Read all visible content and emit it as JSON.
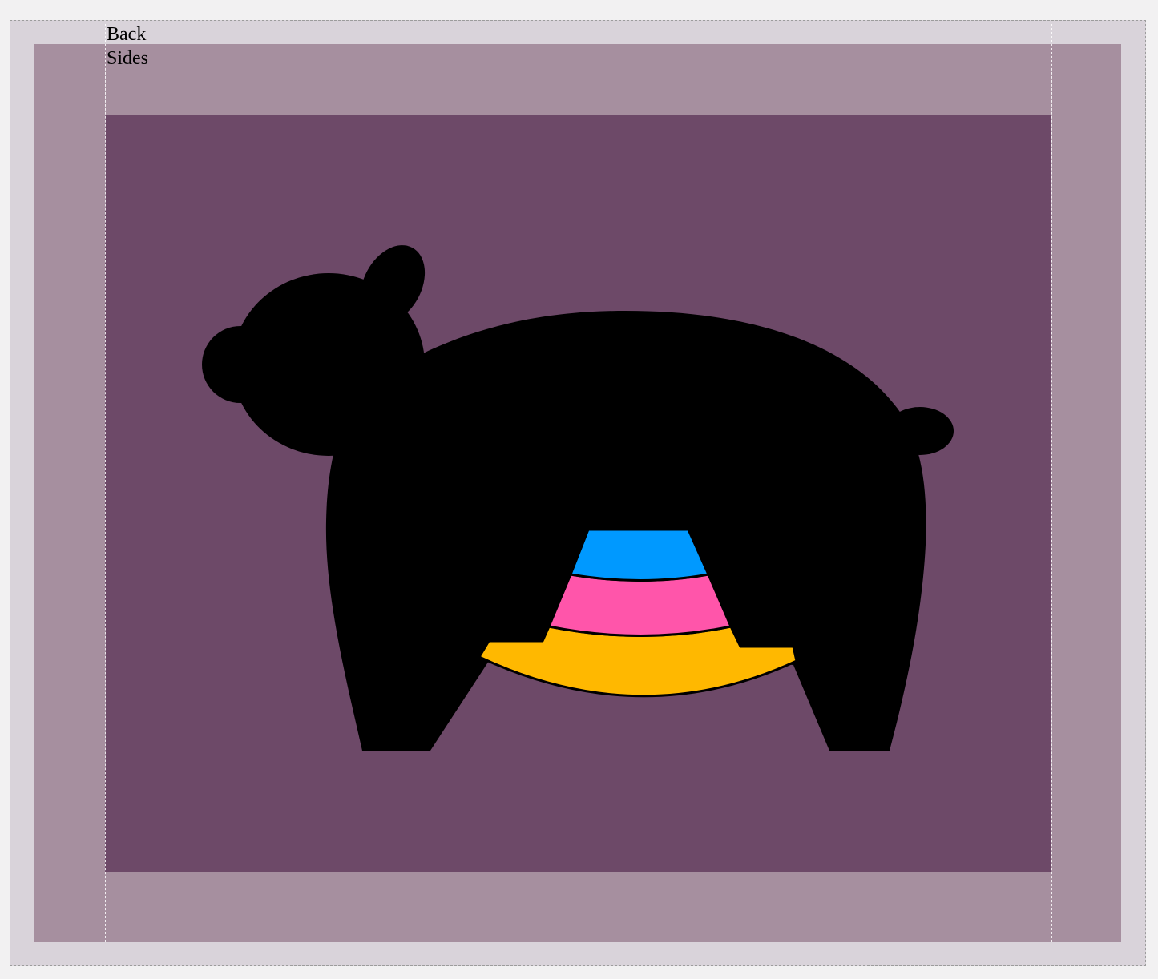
{
  "labels": {
    "back": "Back",
    "sides": "Sides"
  },
  "colors": {
    "page_background": "#f2f1f2",
    "outer_margin": "#d9d3da",
    "sides_panel": "#a68f9f",
    "back_panel": "#6d4968",
    "bear": "#000000",
    "stripe_blue": "#0099ff",
    "stripe_pink": "#ff55aa",
    "stripe_yellow": "#ffb800"
  },
  "icons": {
    "bear": "bear-silhouette-icon"
  }
}
